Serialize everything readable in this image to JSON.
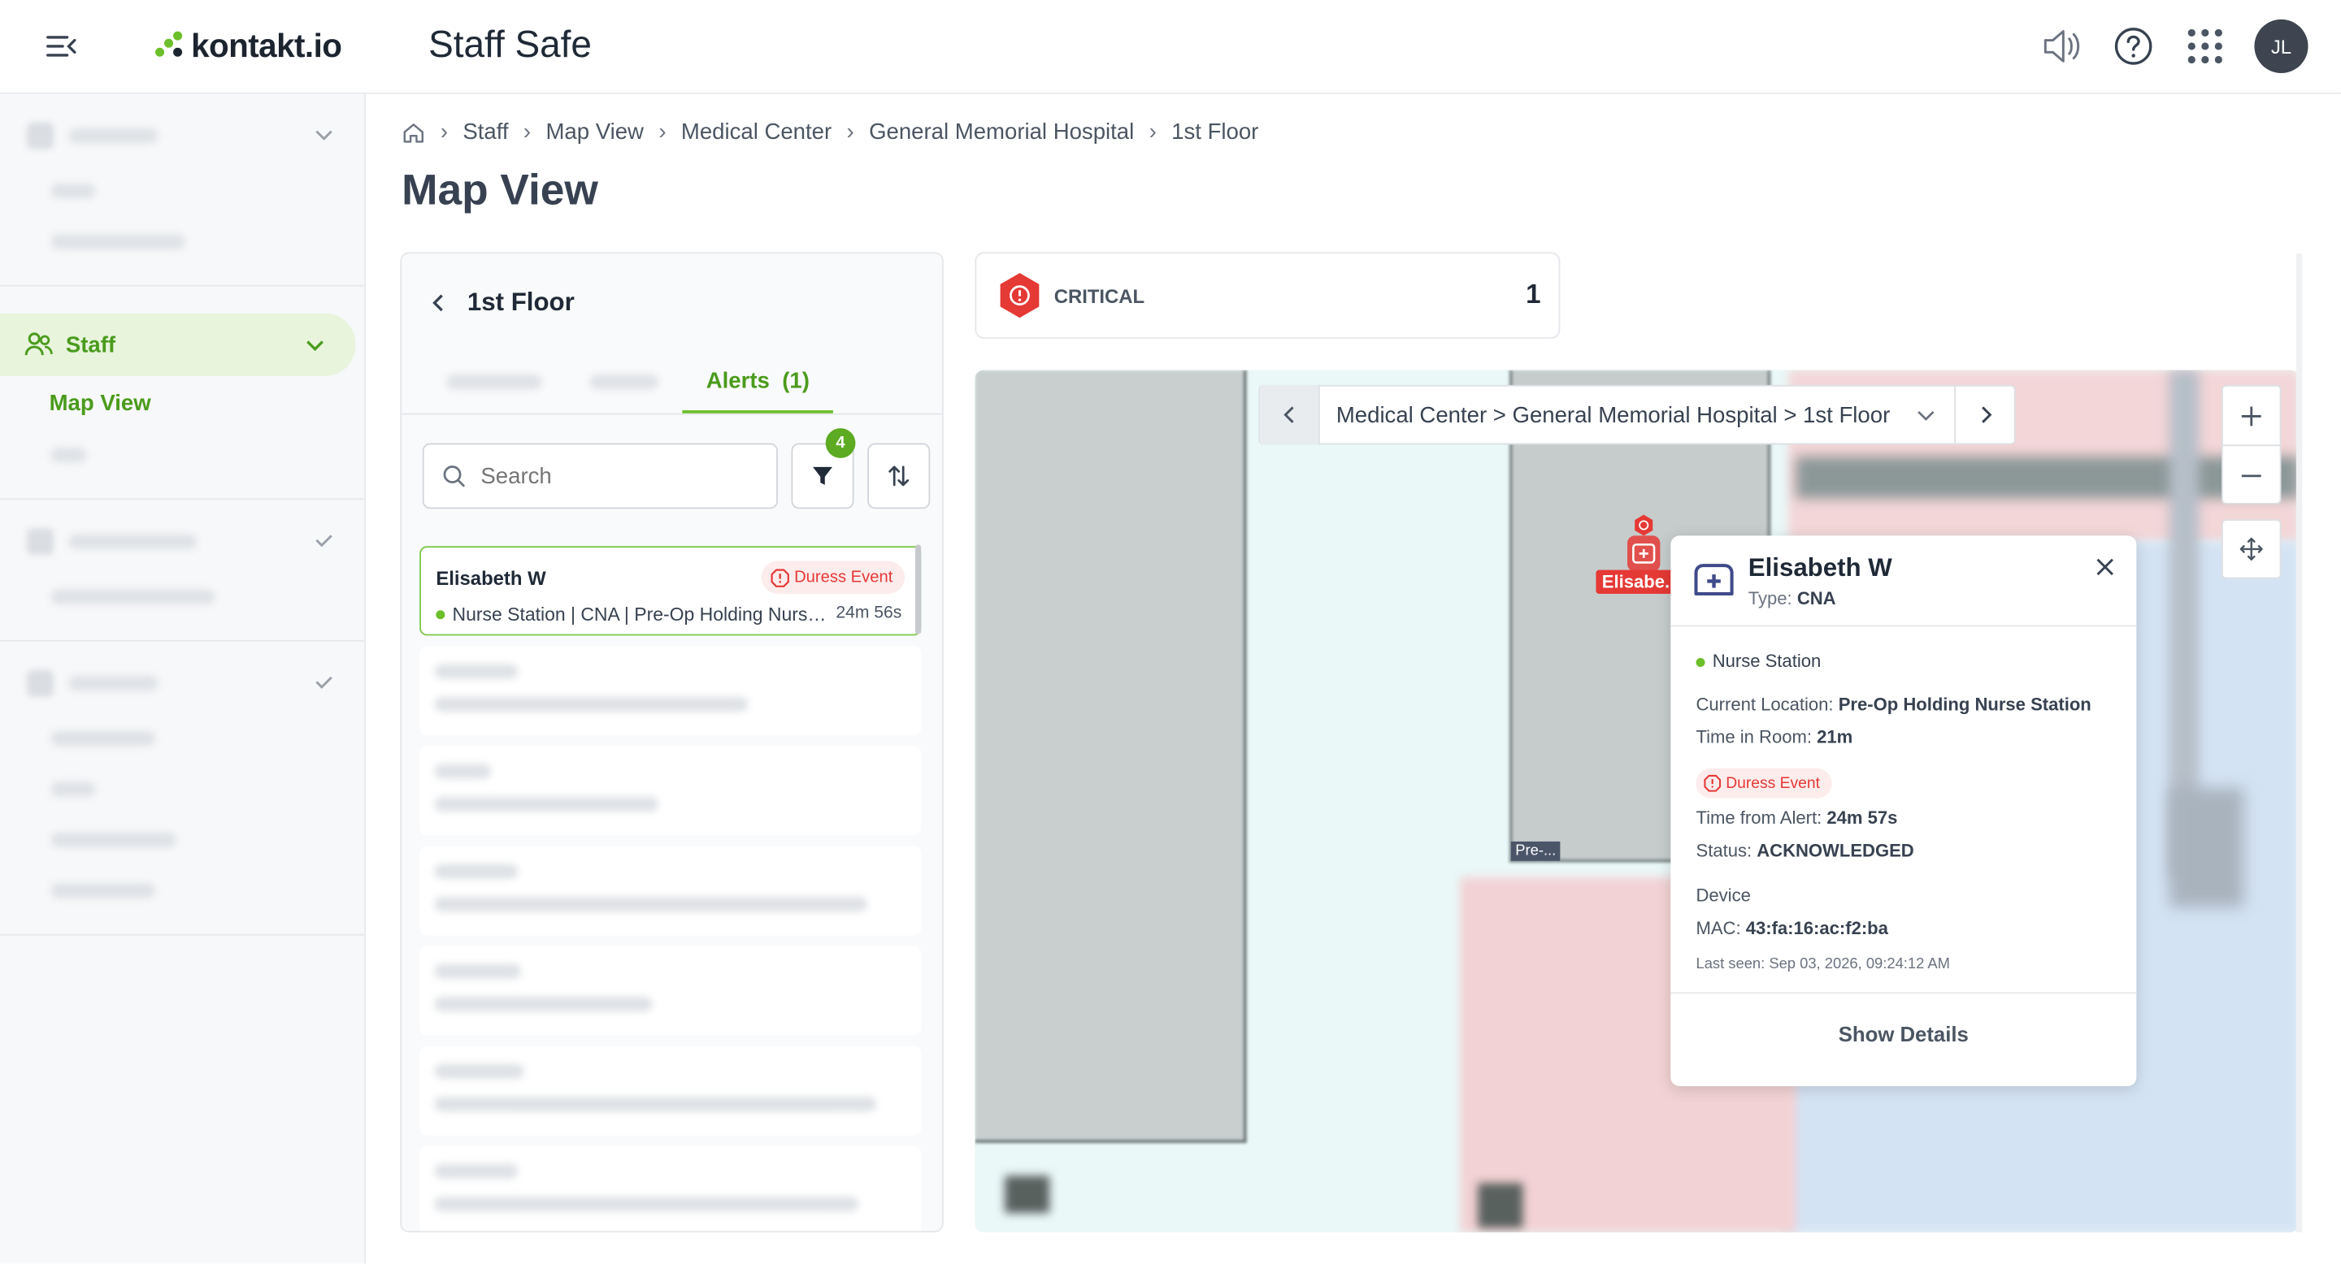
{
  "header": {
    "brand": "kontakt.io",
    "app_title": "Staff Safe",
    "avatar_initials": "JL"
  },
  "sidebar": {
    "active_section": "Staff",
    "active_item": "Map View"
  },
  "breadcrumb": [
    "Staff",
    "Map View",
    "Medical Center",
    "General Memorial Hospital",
    "1st Floor"
  ],
  "page_title": "Map View",
  "panel": {
    "title": "1st Floor",
    "active_tab": "Alerts",
    "active_tab_count": "(1)",
    "search_placeholder": "Search",
    "filter_badge": "4",
    "alert": {
      "name": "Elisabeth W",
      "badge": "Duress Event",
      "location": "Nurse Station | CNA | Pre-Op Holding Nurs…",
      "time": "24m 56s"
    }
  },
  "critical": {
    "label": "CRITICAL",
    "count": "1"
  },
  "map": {
    "nav_path": "Medical Center > General Memorial Hospital > 1st Floor",
    "pin_label": "Elisabe...",
    "room_label": "Pre-..."
  },
  "popup": {
    "name": "Elisabeth W",
    "type_label": "Type:",
    "type_value": "CNA",
    "station": "Nurse Station",
    "location_label": "Current Location:",
    "location_value": "Pre-Op Holding Nurse Station",
    "time_room_label": "Time in Room:",
    "time_room_value": "21m",
    "badge": "Duress Event",
    "time_alert_label": "Time from Alert:",
    "time_alert_value": "24m 57s",
    "status_label": "Status:",
    "status_value": "ACKNOWLEDGED",
    "device_label": "Device",
    "mac_label": "MAC:",
    "mac_value": "43:fa:16:ac:f2:ba",
    "last_seen": "Last seen: Sep 03, 2026, 09:24:12 AM",
    "show_details": "Show Details"
  },
  "colors": {
    "brand_green": "#6cbf2a",
    "critical_red": "#e53935"
  }
}
